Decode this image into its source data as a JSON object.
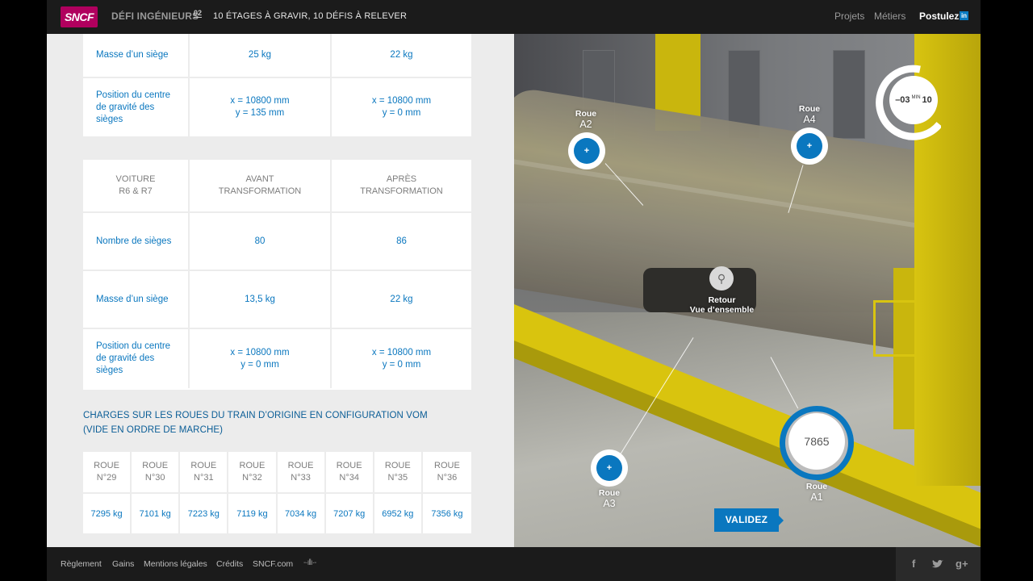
{
  "header": {
    "logo": "SNCF",
    "brand": "DÉFI INGÉNIEURS",
    "episode": "02",
    "tagline": "10 ÉTAGES À GRAVIR, 10 DÉFIS À RELEVER",
    "nav": [
      "Projets",
      "Métiers",
      "Postulez"
    ],
    "linkedin_icon": "in"
  },
  "table_top": {
    "rows": [
      {
        "label": "Masse d’un siège",
        "before": "25 kg",
        "after": "22 kg"
      },
      {
        "label": "Position du centre de gravité des sièges",
        "before": "x = 10800 mm\ny = 135 mm",
        "after": "x = 10800 mm\ny = 0 mm"
      }
    ]
  },
  "table_r6r7": {
    "headers": [
      "VOITURE\nR6 & R7",
      "AVANT\nTRANSFORMATION",
      "APRÈS\nTRANSFORMATION"
    ],
    "rows": [
      {
        "label": "Nombre de sièges",
        "before": "80",
        "after": "86"
      },
      {
        "label": "Masse d’un siège",
        "before": "13,5 kg",
        "after": "22 kg"
      },
      {
        "label": "Position du centre de gravité des sièges",
        "before": "x = 10800 mm\ny = 0 mm",
        "after": "x = 10800 mm\ny = 0 mm"
      }
    ]
  },
  "wheel_section": {
    "title": "CHARGES SUR LES ROUES DU TRAIN D’ORIGINE EN CONFIGURATION VOM\n(VIDE EN ORDRE DE MARCHE)",
    "headers": [
      "ROUE\nN°29",
      "ROUE\nN°30",
      "ROUE\nN°31",
      "ROUE\nN°32",
      "ROUE\nN°33",
      "ROUE\nN°34",
      "ROUE\nN°35",
      "ROUE\nN°36"
    ],
    "values": [
      "7295 kg",
      "7101 kg",
      "7223 kg",
      "7119 kg",
      "7034 kg",
      "7207 kg",
      "6952 kg",
      "7356 kg"
    ]
  },
  "scene": {
    "hotspots": {
      "a2": {
        "word": "Roue",
        "id": "A2",
        "symbol": "+"
      },
      "a4": {
        "word": "Roue",
        "id": "A4",
        "symbol": "+"
      },
      "a3": {
        "word": "Roue",
        "id": "A3",
        "symbol": "+"
      },
      "a1": {
        "word": "Roue",
        "id": "A1"
      }
    },
    "zoom": {
      "line1": "Retour",
      "line2": "Vue d’ensemble"
    },
    "timer": {
      "minutes": "–03",
      "unit": "MIN",
      "seconds": "10"
    },
    "answer_value": "7865",
    "validate_label": "VALIDEZ"
  },
  "footer": {
    "links": [
      "Règlement",
      "Gains",
      "Mentions légales",
      "Crédits",
      "SNCF.com"
    ],
    "sound_icon": "sound-wave-icon",
    "social": [
      "f",
      "twitter-bird",
      "g+"
    ]
  },
  "colors": {
    "accent_blue": "#0a77bf",
    "brand_magenta": "#b0005e",
    "scene_yellow": "#d9c40e"
  }
}
